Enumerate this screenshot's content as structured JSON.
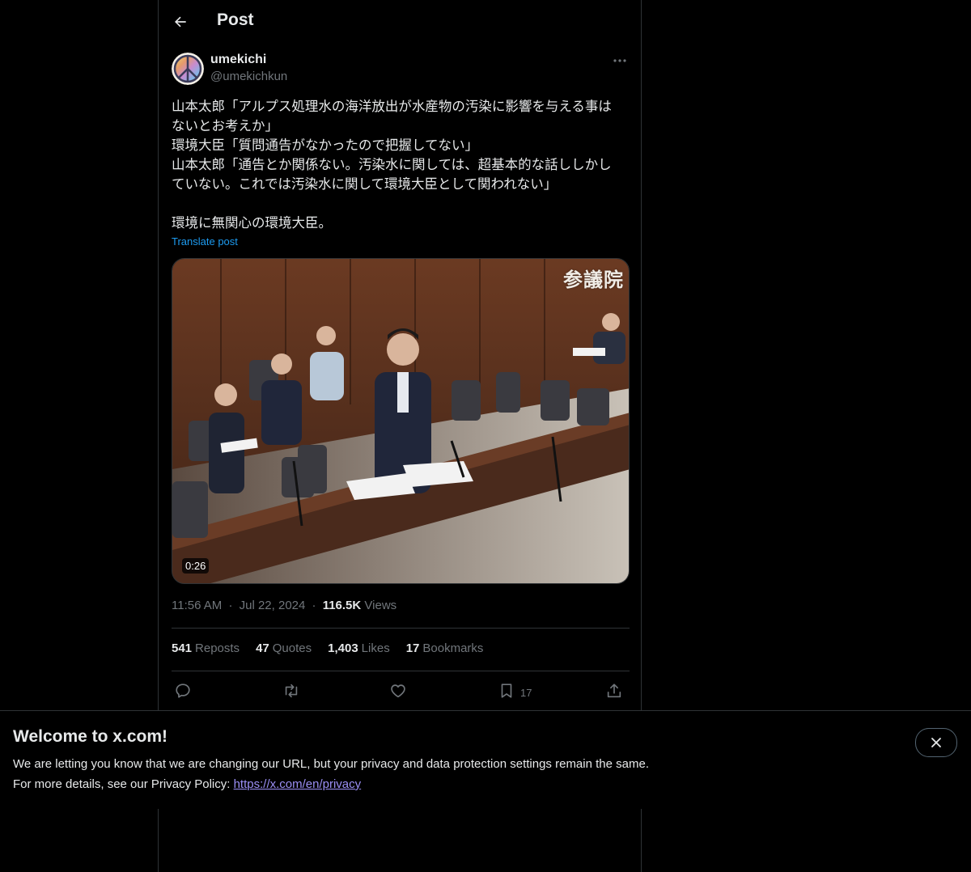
{
  "header": {
    "title": "Post"
  },
  "author": {
    "display_name": "umekichi",
    "handle": "@umekichkun"
  },
  "post": {
    "lines": [
      "山本太郎「アルプス処理水の海洋放出が水産物の汚染に影響を与える事は",
      "ないとお考えか」",
      "環境大臣「質問通告がなかったので把握してない」",
      "山本太郎「通告とか関係ない。汚染水に関しては、超基本的な話ししかし",
      "ていない。これでは汚染水に関して環境大臣として関われない」",
      "",
      "環境に無関心の環境大臣。"
    ],
    "translate_label": "Translate post"
  },
  "media": {
    "watermark": "参議院",
    "duration": "0:26"
  },
  "meta": {
    "time": "11:56 AM",
    "date": "Jul 22, 2024",
    "views": "116.5K",
    "views_label": "Views",
    "separator": "·"
  },
  "stats": {
    "reposts": "541",
    "reposts_label": "Reposts",
    "quotes": "47",
    "quotes_label": "Quotes",
    "likes": "1,403",
    "likes_label": "Likes",
    "bookmarks": "17",
    "bookmarks_label": "Bookmarks"
  },
  "actions": {
    "bookmark_count": "17"
  },
  "banner": {
    "title": "Welcome to x.com!",
    "line1": "We are letting you know that we are changing our URL, but your privacy and data protection settings remain the same.",
    "line2_prefix": "For more details, see our Privacy Policy: ",
    "link": "https://x.com/en/privacy"
  },
  "colors": {
    "background": "#000000",
    "text": "#e7e9ea",
    "muted": "#71767b",
    "accent": "#1d9bf0",
    "border": "#2f3336",
    "link": "#9b8ff5"
  },
  "icons": [
    "back-arrow-icon",
    "more-icon",
    "reply-icon",
    "repost-icon",
    "like-icon",
    "bookmark-icon",
    "share-icon",
    "close-icon"
  ]
}
